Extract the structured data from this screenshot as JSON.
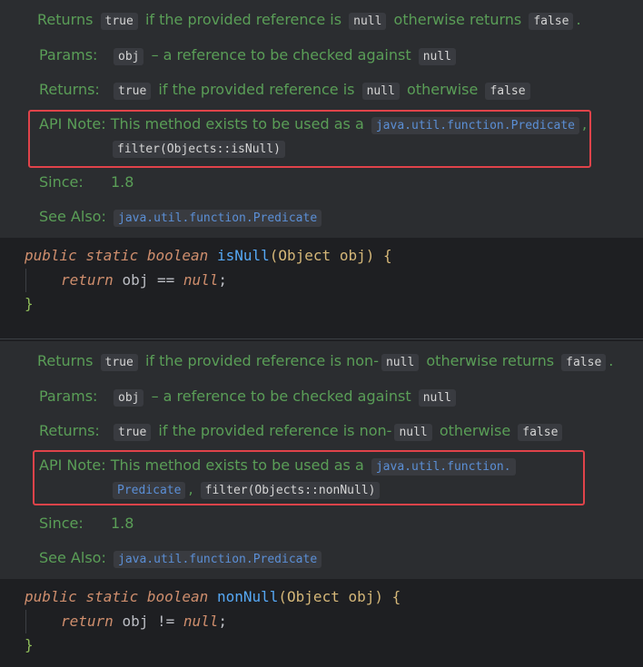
{
  "block1": {
    "summary": {
      "pre": "Returns",
      "code1": "true",
      "mid": "if the provided reference is",
      "code2": "null",
      "mid2": "otherwise returns",
      "code3": "false",
      "end": "."
    },
    "params": {
      "label": "Params:",
      "code": "obj",
      "text": "– a reference to be checked against",
      "code2": "null"
    },
    "returns": {
      "label": "Returns:",
      "code": "true",
      "text": "if the provided reference is",
      "code2": "null",
      "text2": "otherwise",
      "code3": "false"
    },
    "api_note": {
      "label": "API Note:",
      "text": "This method exists to be used as a",
      "link": "java.util.function.Predicate",
      "comma": ",",
      "code": "filter(Objects::isNull)"
    },
    "since": {
      "label": "Since:",
      "value": "1.8"
    },
    "see_also": {
      "label": "See Also:",
      "link": "java.util.function.Predicate"
    },
    "code": {
      "kw1": "public",
      "kw2": "static",
      "kw3": "boolean",
      "method": "isNull",
      "paren": "(",
      "type": "Object",
      "param": "obj",
      "close": ") {",
      "ret": "return",
      "expr_var": "obj",
      "op": "==",
      "nullkw": "null",
      "semi": ";",
      "brace_close": "}"
    }
  },
  "block2": {
    "summary": {
      "pre": "Returns",
      "code1": "true",
      "mid": "if the provided reference is non-",
      "code2": "null",
      "mid2": "otherwise returns",
      "code3": "false",
      "end": "."
    },
    "params": {
      "label": "Params:",
      "code": "obj",
      "text": "– a reference to be checked against",
      "code2": "null"
    },
    "returns": {
      "label": "Returns:",
      "code": "true",
      "text": "if the provided reference is non-",
      "code2": "null",
      "text2": "otherwise",
      "code3": "false"
    },
    "api_note": {
      "label": "API Note:",
      "text": "This method exists to be used as a",
      "link1": "java.util.function.",
      "link2": "Predicate",
      "comma": ",",
      "code": "filter(Objects::nonNull)"
    },
    "since": {
      "label": "Since:",
      "value": "1.8"
    },
    "see_also": {
      "label": "See Also:",
      "link": "java.util.function.Predicate"
    },
    "code": {
      "kw1": "public",
      "kw2": "static",
      "kw3": "boolean",
      "method": "nonNull",
      "paren": "(",
      "type": "Object",
      "param": "obj",
      "close": ") {",
      "ret": "return",
      "expr_var": "obj",
      "op": "!=",
      "nullkw": "null",
      "semi": ";",
      "brace_close": "}"
    }
  }
}
